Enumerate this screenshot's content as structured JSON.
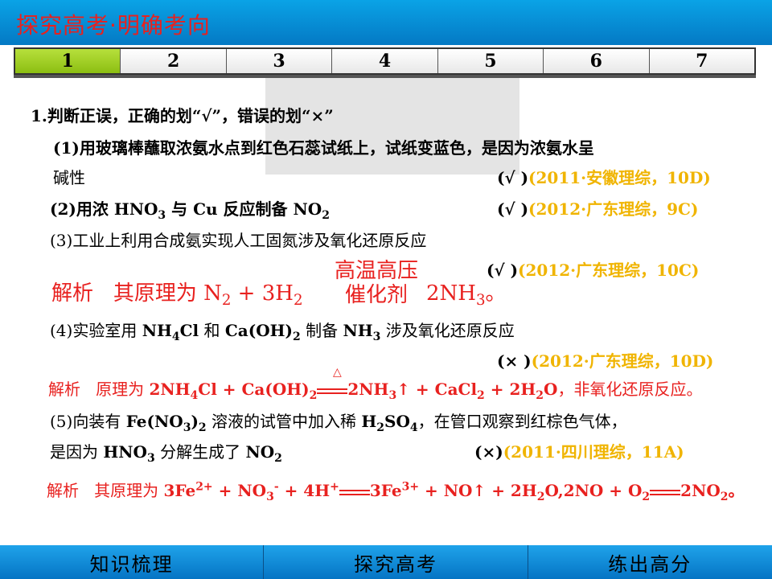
{
  "header": {
    "title": "探究高考·明确考向"
  },
  "tabs": [
    "1",
    "2",
    "3",
    "4",
    "5",
    "6",
    "7"
  ],
  "q1": {
    "stem": "1.判断正误，正确的划“√”，错误的划“×”",
    "item1_a": "(1)用玻璃棒蘸取浓氨水点到红色石蕊试纸上，试纸变蓝色，是因为浓氨水呈",
    "item1_b": "碱性",
    "item1_mark": "(√ )",
    "item1_src": "(2011·安徽理综，10D)",
    "item2_pre": "(2)用浓 ",
    "item2_mid": " 与 Cu 反应制备 ",
    "item2_mark": "(√ )",
    "item2_src": "(2012·广东理综，9C)",
    "item3": "(3)工业上利用合成氨实现人工固氮涉及氧化还原反应",
    "item3_mark": "(√ )",
    "item3_src": "(2012·广东理综，10C)",
    "jx3_label": "解析",
    "jx3_text": "其原理为",
    "cond_top": "高温高压",
    "cond_bottom": "催化剂",
    "item4_pre": "(4)实验室用 ",
    "item4_mid1": " 和 ",
    "item4_mid2": " 制备 ",
    "item4_post": " 涉及氧化还原反应",
    "item4_mark": "(× )",
    "item4_src": "(2012·广东理综，10D)",
    "jx4_label": "解析",
    "jx4_text": "原理为",
    "jx4_tail": "，非氧化还原反应。",
    "item5_pre": "(5)向装有 ",
    "item5_mid": " 溶液的试管中加入稀 ",
    "item5_post": "，在管口观察到红棕色气体，",
    "item5_b_pre": "是因为 ",
    "item5_b_mid": " 分解生成了 ",
    "item5_mark": "(×)",
    "item5_src": "(2011·四川理综，11A)",
    "jx5_label": "解析",
    "jx5_text": "其原理为"
  },
  "footer": {
    "btn1": "知识梳理",
    "btn2": "探究高考",
    "btn3": "练出高分"
  }
}
